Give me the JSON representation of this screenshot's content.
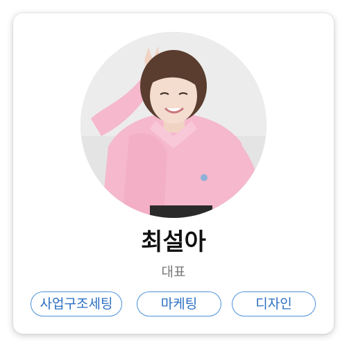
{
  "profile": {
    "name": "최설아",
    "role": "대표",
    "photo_alt": "최설아"
  },
  "tags": [
    {
      "label": "사업구조세팅"
    },
    {
      "label": "마케팅"
    },
    {
      "label": "디자인"
    }
  ],
  "colors": {
    "tag_border": "#4a90d9",
    "tag_text": "#2a6fc2",
    "name_text": "#111111",
    "role_text": "#777777"
  }
}
